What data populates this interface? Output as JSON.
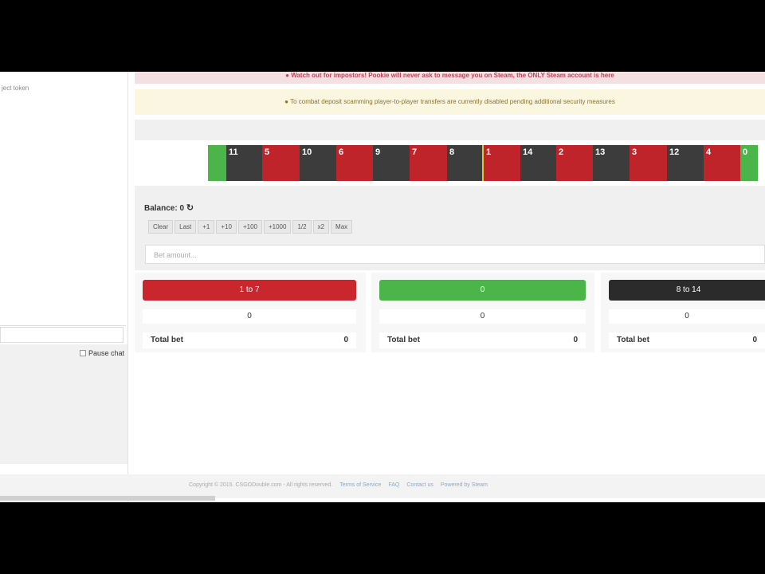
{
  "chat": {
    "message": "ject token",
    "pause_label": "Pause chat"
  },
  "alerts": {
    "danger": "● Watch out for impostors! Pookie will never ask to message you on Steam, the ONLY Steam account is here",
    "warning": "● To combat deposit scamming player-to-player transfers are currently disabled pending additional security measures"
  },
  "roulette": {
    "cells": [
      {
        "n": "",
        "c": "green"
      },
      {
        "n": "11",
        "c": "black"
      },
      {
        "n": "5",
        "c": "red"
      },
      {
        "n": "10",
        "c": "black"
      },
      {
        "n": "6",
        "c": "red"
      },
      {
        "n": "9",
        "c": "black"
      },
      {
        "n": "7",
        "c": "red"
      },
      {
        "n": "8",
        "c": "black"
      },
      {
        "n": "1",
        "c": "red"
      },
      {
        "n": "14",
        "c": "black"
      },
      {
        "n": "2",
        "c": "red"
      },
      {
        "n": "13",
        "c": "black"
      },
      {
        "n": "3",
        "c": "red"
      },
      {
        "n": "12",
        "c": "black"
      },
      {
        "n": "4",
        "c": "red"
      },
      {
        "n": "0",
        "c": "green"
      }
    ],
    "colors": {
      "red": "#c0242b",
      "black": "#3c3c3c",
      "green": "#4cb54a"
    }
  },
  "bet": {
    "balance_label": "Balance: 0",
    "refresh_icon": "↻",
    "buttons": [
      "Clear",
      "Last",
      "+1",
      "+10",
      "+100",
      "+1000",
      "1/2",
      "x2",
      "Max"
    ],
    "placeholder": "Bet amount..."
  },
  "columns": [
    {
      "label": "1 to 7",
      "color": "#c9262e",
      "value": "0",
      "total_label": "Total bet",
      "total": "0"
    },
    {
      "label": "0",
      "color": "#4cb54a",
      "value": "0",
      "total_label": "Total bet",
      "total": "0"
    },
    {
      "label": "8 to 14",
      "color": "#2b2b2b",
      "value": "0",
      "total_label": "Total bet",
      "total": "0"
    }
  ],
  "footer": {
    "copyright": "Copyright © 2015. CSGODouble.com - All rights reserved.",
    "links": [
      "Terms of Service",
      "FAQ",
      "Contact us",
      "Powered by Steam"
    ]
  }
}
